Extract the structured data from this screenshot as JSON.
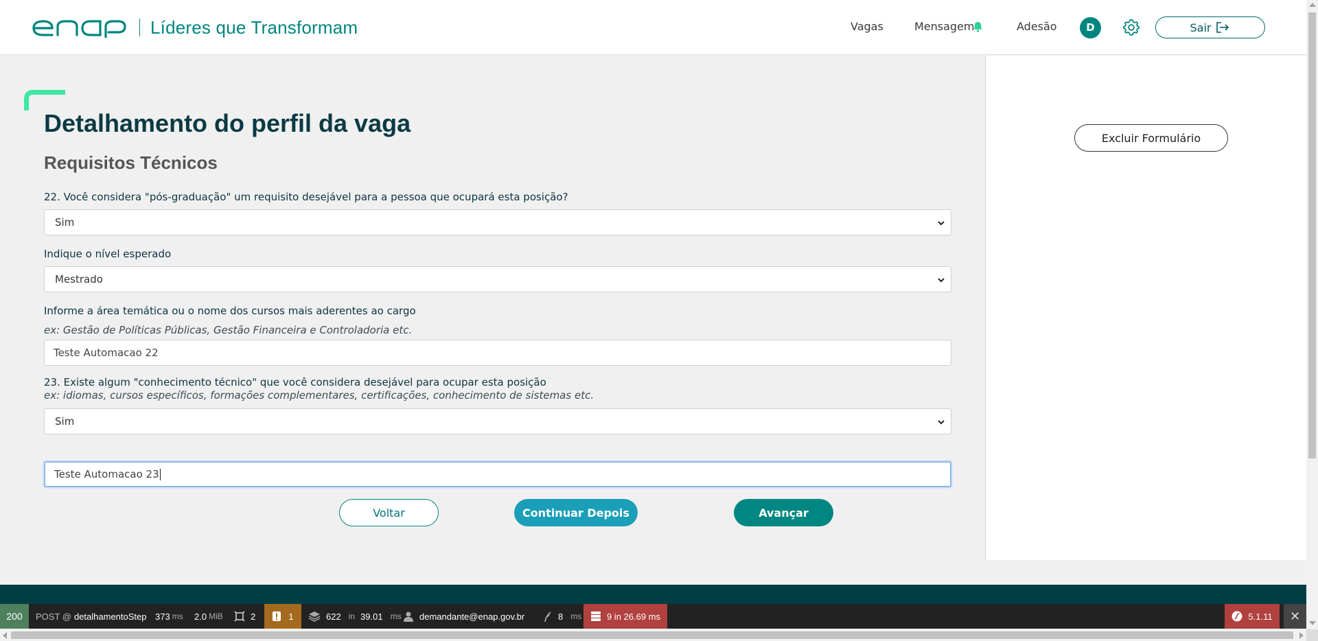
{
  "header": {
    "tagline": "Líderes que Transformam",
    "nav": {
      "vagas": "Vagas",
      "mensagem": "Mensagem",
      "adesao": "Adesão"
    },
    "avatar_letter": "D",
    "sair_label": "Sair",
    "icons": {
      "logo": "enap-logo",
      "bell": "bell-icon",
      "gear": "gear-icon",
      "logout": "logout-icon"
    }
  },
  "colors": {
    "brand_teal": "#00857f",
    "dark_title": "#0b3a44",
    "accent_green": "#3ee8a4",
    "continue_blue": "#1b9fb8",
    "footer": "#003e46"
  },
  "main": {
    "page_title": "Detalhamento do perfil da vaga",
    "section_title": "Requisitos Técnicos",
    "q22_label": "22. Você considera \"pós-graduação\" um requisito desejável para a pessoa que ocupará esta posição?",
    "q22_value": "Sim",
    "nivel_label": "Indique o nível esperado",
    "nivel_value": "Mestrado",
    "area_label": "Informe a área temática ou o nome dos cursos mais aderentes ao cargo",
    "area_hint": "ex: Gestão de Políticas Públicas, Gestão Financeira e Controladoria etc.",
    "area_value": "Teste Automacao 22",
    "q23_label": "23. Existe algum \"conhecimento técnico\" que você considera desejável para ocupar esta posição",
    "q23_hint": "ex: idiomas, cursos específicos, formações complementares, certificações, conhecimento de sistemas etc.",
    "q23_value": "Sim",
    "q23_text_value": "Teste Automacao 23",
    "buttons": {
      "voltar": "Voltar",
      "continuar": "Continuar Depois",
      "avancar": "Avançar"
    }
  },
  "side_panel": {
    "excluir": "Excluir Formulário"
  },
  "debug_toolbar": {
    "status": "200",
    "method": "POST @",
    "route": "detalhamentoStep",
    "time_value": "373",
    "time_unit": "ms",
    "memory_value": "2.0",
    "memory_unit": "MiB",
    "forms_count": "2",
    "warnings_count": "1",
    "db_queries": "622",
    "db_in": "in",
    "db_time": "39.01",
    "db_unit": "ms",
    "user": "demandante@enap.gov.br",
    "twig_time": "8",
    "twig_unit": "ms",
    "cache_text": "9 in 26.69 ms",
    "symfony_version": "5.1.11"
  }
}
